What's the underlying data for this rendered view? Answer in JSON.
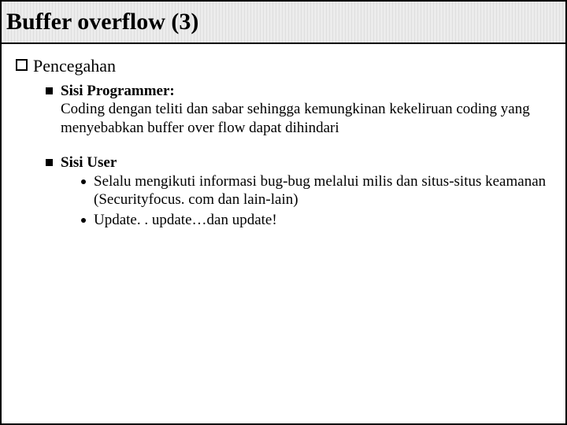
{
  "title": "Buffer overflow (3)",
  "section": {
    "heading": "Pencegahan"
  },
  "items": [
    {
      "title": "Sisi Programmer:",
      "desc": "Coding dengan teliti dan sabar sehingga kemungkinan kekeliruan coding yang menyebabkan buffer over flow dapat dihindari"
    },
    {
      "title": "Sisi User",
      "subs": [
        "Selalu mengikuti informasi bug-bug melalui milis dan situs-situs keamanan (Securityfocus. com dan lain-lain)",
        "Update. . update…dan update!"
      ]
    }
  ]
}
